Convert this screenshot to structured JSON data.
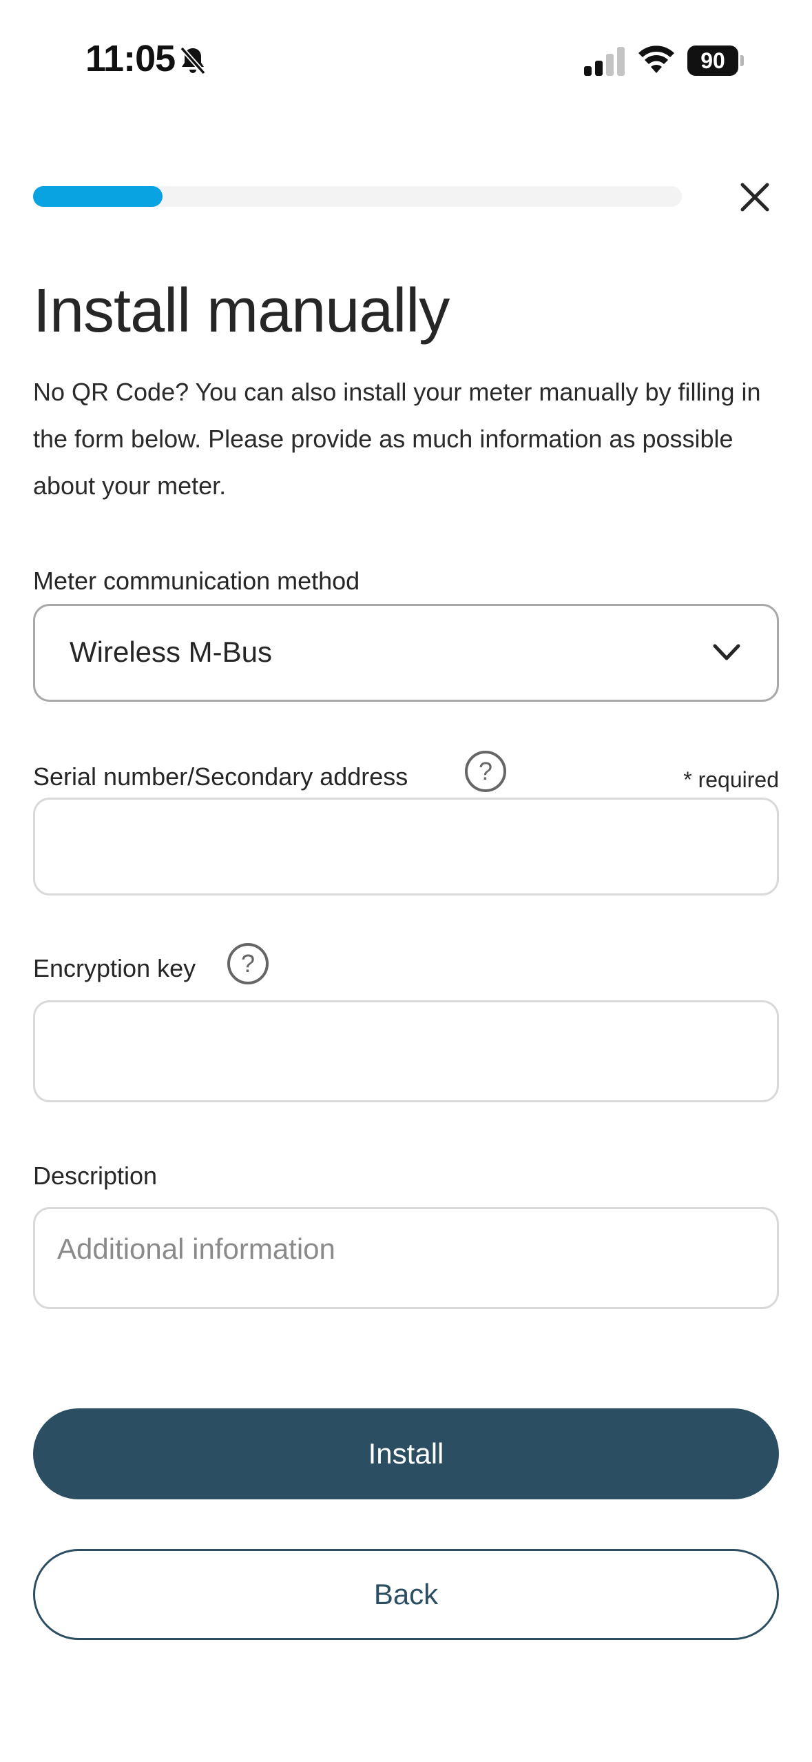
{
  "status_bar": {
    "time": "11:05",
    "battery": "90",
    "icons": [
      "bell-slash-icon",
      "cellular-signal-icon",
      "wifi-icon",
      "battery-icon"
    ]
  },
  "progress": {
    "fraction": 0.2,
    "color": "#0aa3e2"
  },
  "header": {
    "close_icon": "close-icon"
  },
  "page": {
    "title": "Install manually",
    "intro": "No QR Code? You can also install your meter manually by filling in the form below. Please provide as much information as possible about your meter."
  },
  "form": {
    "method": {
      "label": "Meter communication method",
      "selected": "Wireless M-Bus",
      "icon": "chevron-down-icon"
    },
    "serial": {
      "label": "Serial number/Secondary address",
      "required_note": "* required",
      "value": "",
      "placeholder": "",
      "help_icon": "help-icon"
    },
    "encryption": {
      "label": "Encryption key",
      "value": "",
      "placeholder": "",
      "help_icon": "help-icon"
    },
    "description": {
      "label": "Description",
      "value": "",
      "placeholder": "Additional information"
    }
  },
  "actions": {
    "install_label": "Install",
    "back_label": "Back"
  },
  "colors": {
    "primary": "#2c4e63",
    "accent": "#0aa3e2",
    "text": "#262626"
  }
}
